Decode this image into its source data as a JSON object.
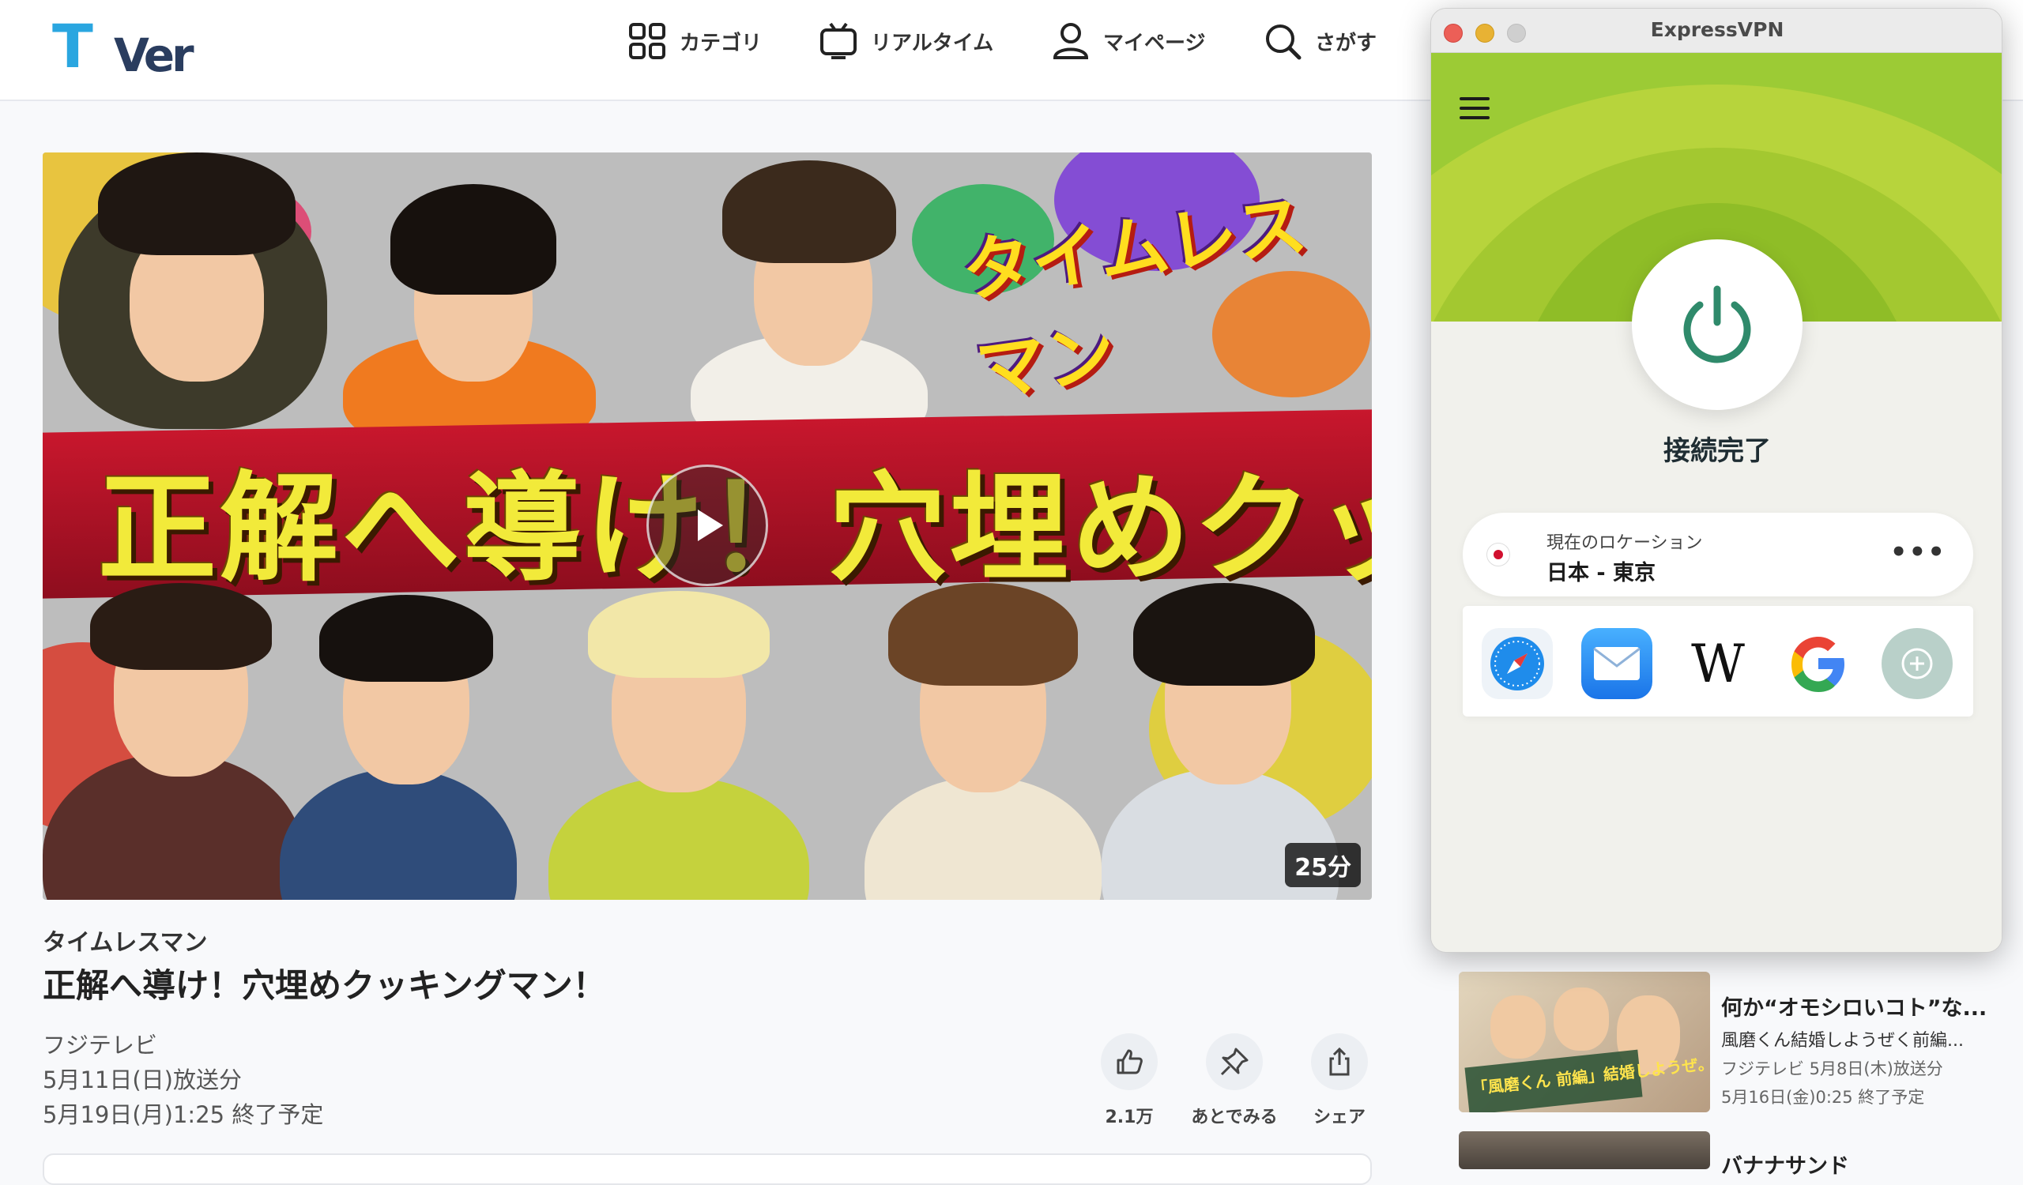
{
  "tver": {
    "logo_t": "T",
    "logo_er": "Ver",
    "nav": [
      {
        "label": "カテゴリ",
        "icon": "category-icon"
      },
      {
        "label": "リアルタイム",
        "icon": "tv-icon"
      },
      {
        "label": "マイページ",
        "icon": "user-icon"
      },
      {
        "label": "さがす",
        "icon": "search-icon"
      }
    ]
  },
  "video": {
    "thumbnail_title_art": "正解へ導け！穴埋めクッキングマン！",
    "thumbnail_logo_art": "タイムレスマン",
    "duration": "25分",
    "series": "タイムレスマン",
    "title": "正解へ導け！穴埋めクッキングマン！",
    "channel": "フジテレビ",
    "broadcast": "5月11日(日)放送分",
    "expires": "5月19日(月)1:25 終了予定",
    "actions": [
      {
        "label": "2.1万",
        "icon": "thumbs-up-icon"
      },
      {
        "label": "あとでみる",
        "icon": "pin-icon"
      },
      {
        "label": "シェア",
        "icon": "share-icon"
      }
    ]
  },
  "sidebar": {
    "items": [
      {
        "title": "何か“オモシロいコト”な...",
        "subtitle": "風磨くん結婚しようぜく前編...",
        "meta1": "フジテレビ 5月8日(木)放送分",
        "meta2": "5月16日(金)0:25 終了予定",
        "thumb_text": "「風磨くん 前編」結婚しようぜ。"
      },
      {
        "title": "バナナサンド"
      }
    ]
  },
  "vpn": {
    "window_title": "ExpressVPN",
    "status": "接続完了",
    "location_label": "現在のロケーション",
    "location_value": "日本 - 東京",
    "more": "•••",
    "shortcuts": [
      "safari-icon",
      "mail-icon",
      "wikipedia-icon",
      "google-icon",
      "add-shortcut-icon"
    ],
    "colors": {
      "accent_green": "#9ccb35",
      "power_green": "#2f8a6b",
      "traffic_red": "#ec5f57",
      "traffic_yellow": "#e8b234",
      "traffic_gray": "#cfcfcf"
    }
  }
}
